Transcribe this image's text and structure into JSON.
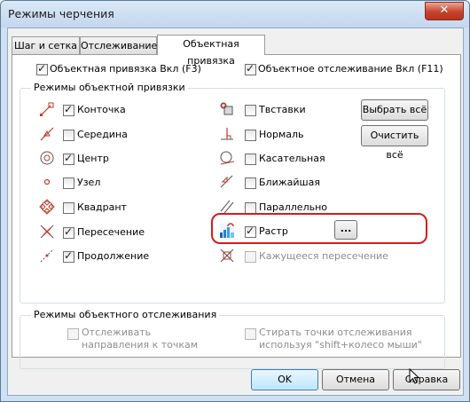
{
  "window": {
    "title": "Режимы черчения",
    "close_glyph": "✕"
  },
  "tabs": [
    {
      "label": "Шаг и сетка"
    },
    {
      "label": "Отслеживание"
    },
    {
      "label": "Объектная привязка"
    }
  ],
  "top_options": {
    "osnap_on": {
      "label": "Объектная привязка Вкл (F3)",
      "checked": true
    },
    "otrack_on": {
      "label": "Объектное отслеживание Вкл (F11)",
      "checked": true
    }
  },
  "osnap_group": {
    "title": "Режимы объектной привязки",
    "left": [
      {
        "label": "Конточка",
        "checked": true
      },
      {
        "label": "Середина",
        "checked": false
      },
      {
        "label": "Центр",
        "checked": true
      },
      {
        "label": "Узел",
        "checked": false
      },
      {
        "label": "Квадрант",
        "checked": false
      },
      {
        "label": "Пересечение",
        "checked": true
      },
      {
        "label": "Продолжение",
        "checked": true
      }
    ],
    "right": [
      {
        "label": "Твставки",
        "checked": false
      },
      {
        "label": "Нормаль",
        "checked": false
      },
      {
        "label": "Касательная",
        "checked": false
      },
      {
        "label": "Ближайшая",
        "checked": false
      },
      {
        "label": "Параллельно",
        "checked": false
      },
      {
        "label": "Растр",
        "checked": true
      },
      {
        "label": "Кажущееся пересечение",
        "checked": false
      }
    ],
    "select_all": "Выбрать всё",
    "clear_all": "Очистить всё",
    "raster_settings": "..."
  },
  "tracking_group": {
    "title": "Режимы объектного отслеживания",
    "track_directions": {
      "label_line1": "Отслеживать",
      "label_line2": "направления к точкам",
      "checked": false
    },
    "erase_points": {
      "label_line1": "Стирать точки отслеживания",
      "label_line2": "используя \"shift+колесо мыши\"",
      "checked": false
    }
  },
  "footer": {
    "ok": "OK",
    "cancel": "Отмена",
    "help": "Справка"
  },
  "colors": {
    "snap_marker": "#c0392b",
    "highlight": "#d01e1e",
    "title_bg": "#c9dcf0"
  }
}
